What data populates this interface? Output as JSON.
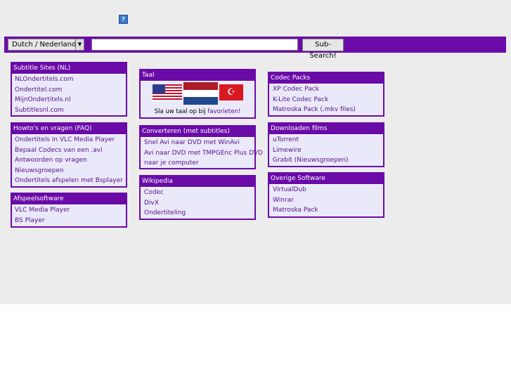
{
  "header": {
    "help_icon_text": "?"
  },
  "search": {
    "language": "Dutch / Nederlands",
    "input_value": "",
    "button_label": "Sub-Search!"
  },
  "colors": {
    "accent": "#6a0ba8",
    "panel_bg": "#e9e9fa",
    "link": "#5a0f86",
    "page_bg": "#ececec"
  },
  "column1": [
    {
      "title": "Subtitle Sites (NL)",
      "items": [
        "NLOndertitels.com",
        "Ondertitel.com",
        "MijnOndertitels.nl",
        "Subtitlesnl.com"
      ]
    },
    {
      "title": "Howto's en vragen (FAQ)",
      "items": [
        "Ondertitels in VLC Media Player",
        "Bepaal Codecs van een .avi",
        "Antwoorden op vragen",
        "Nieuwsgroepen",
        "Ondertitels afspelen met Bsplayer"
      ]
    },
    {
      "title": "Afspeelsoftware",
      "items": [
        "VLC Media Player",
        "BS Player"
      ]
    }
  ],
  "column2": {
    "taal": {
      "title": "Taal",
      "text": "Sla uw taal op bij ",
      "link": "favorieten!",
      "flag_tr_symbol": "☪"
    },
    "converteren": {
      "title": "Converteren (met subtitles)",
      "items": [
        "Snel Avi naar DVD met WinAvi",
        "Avi naar DVD met TMPGEnc Plus DVD",
        "naar je computer"
      ]
    },
    "wikipedia": {
      "title": "Wikipedia",
      "items": [
        "Codec",
        "DivX",
        "Ondertiteling"
      ]
    }
  },
  "column3": [
    {
      "title": "Codec Packs",
      "items": [
        "XP Codec Pack",
        "K-Lite Codec Pack",
        "Matroska Pack (.mkv files)"
      ]
    },
    {
      "title": "Downloaden films",
      "items": [
        "uTorrent",
        "Limewire",
        "Grabit (Nieuwsgroepen)"
      ]
    },
    {
      "title": "Overige Software",
      "items": [
        "VirtualDub",
        "Winrar",
        "Matroska Pack"
      ]
    }
  ]
}
